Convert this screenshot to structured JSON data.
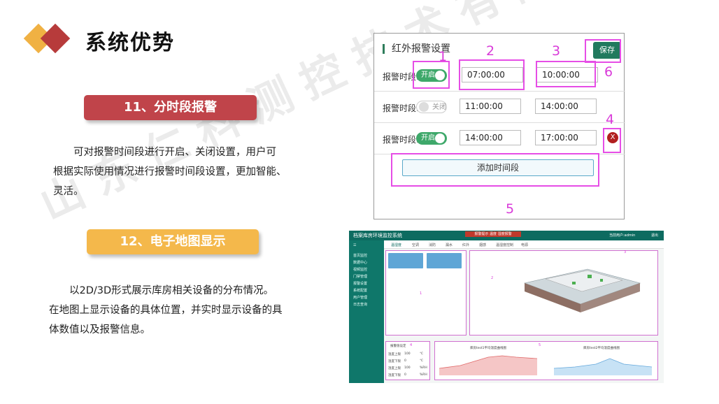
{
  "header": {
    "title": "系统优势"
  },
  "colors": {
    "diamond_orange": "#f0b143",
    "diamond_red": "#b73b3b",
    "pill_red": "#c0444a",
    "pill_orange": "#f4b84b",
    "accent_green": "#217a5e",
    "marker_magenta": "#e64de6"
  },
  "watermark": "山东仁科测控技术有限公司",
  "feature11": {
    "label": "11、分时段报警",
    "desc_line1": "可对报警时间段进行开启、关闭设置，用户可",
    "desc_line2": "根据实际使用情况进行报警时间段设置，更加智能、",
    "desc_line3": "灵活。"
  },
  "feature12": {
    "label": "12、电子地图显示",
    "desc_line1": "以2D/3D形式展示库房相关设备的分布情况。",
    "desc_line2": "在地图上显示设备的具体位置，并实时显示设备的具",
    "desc_line3": "体数值以及报警信息。"
  },
  "alarm_panel": {
    "title": "红外报警设置",
    "save_label": "保存",
    "row_label": "报警时段:",
    "rows": [
      {
        "toggle": "开启",
        "start": "07:00:00",
        "end": "10:00:00"
      },
      {
        "toggle": "关闭",
        "start": "11:00:00",
        "end": "14:00:00"
      },
      {
        "toggle": "开启",
        "start": "14:00:00",
        "end": "17:00:00"
      }
    ],
    "add_label": "添加时间段",
    "delete_label": "X",
    "markers": [
      "1",
      "2",
      "3",
      "4",
      "5",
      "6"
    ]
  },
  "dashboard": {
    "title": "档案库房环境监控系统",
    "alert": "报警提示 温度 湿度报警",
    "user": "当前用户:admin",
    "logout": "退出",
    "sidebar": [
      "首页监控",
      "数据中心",
      "视频监控",
      "门禁管理",
      "报警设置",
      "系统配置",
      "用户管理",
      "日志查询"
    ],
    "tabs": [
      "温湿度",
      "空调",
      "消防",
      "漏水",
      "红外",
      "烟感",
      "温湿度控制",
      "电源"
    ],
    "panel_markers": [
      "1",
      "2",
      "3",
      "4",
      "5"
    ],
    "chart_title_left": "库房test1平均温度曲线图",
    "chart_title_right": "库房test2平均温度曲线图",
    "settings_title": "报警值设定",
    "settings_rows": [
      {
        "label": "温度上限",
        "value": "100",
        "unit": "℃"
      },
      {
        "label": "温度下限",
        "value": "0",
        "unit": "℃"
      },
      {
        "label": "湿度上限",
        "value": "100",
        "unit": "%RH"
      },
      {
        "label": "湿度下限",
        "value": "0",
        "unit": "%RH"
      }
    ]
  }
}
